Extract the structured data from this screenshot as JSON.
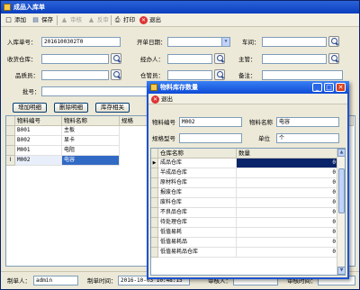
{
  "window": {
    "title": "成品入库单"
  },
  "toolbar": {
    "add": "添加",
    "save": "保存",
    "review": "审核",
    "unreview": "反审",
    "print": "打印",
    "exit": "退出"
  },
  "form": {
    "doc_no_label": "入库单号：",
    "doc_no_value": "2016100302T0",
    "dev_date_label": "开单日期：",
    "workshop_label": "车间：",
    "warehouse_label": "收货仓库：",
    "handler_label": "经办人：",
    "supervisor_label": "主管：",
    "inspector_label": "品质员：",
    "keeper_label": "仓管员：",
    "remark_label": "备注：",
    "batch_label": "批号："
  },
  "buttons": {
    "add_detail": "增加明细",
    "del_detail": "删除明细",
    "stock_related": "库存相关"
  },
  "grid": {
    "headers": [
      "物料编号",
      "物料名称",
      "规格"
    ],
    "rows": [
      [
        "B001",
        "主板"
      ],
      [
        "B002",
        "显卡"
      ],
      [
        "M001",
        "电阻"
      ],
      [
        "M002",
        "电容"
      ]
    ]
  },
  "status": {
    "maker_label": "制单人：",
    "maker_value": "admin",
    "make_time_label": "制单时间：",
    "make_time_value": "2016-10-03 10:48:15",
    "reviewer_label": "审核人：",
    "review_time_label": "审核时间："
  },
  "popup": {
    "title": "物料库存数量",
    "exit": "退出",
    "item_no_label": "物料编号",
    "item_no_value": "M002",
    "item_name_label": "物料名称",
    "item_name_value": "电容",
    "spec_label": "规格型号",
    "unit_label": "单位",
    "unit_value": "个",
    "headers": [
      "仓库名称",
      "数量"
    ],
    "rows": [
      [
        "成品仓库",
        "0"
      ],
      [
        "半成品仓库",
        "0"
      ],
      [
        "原材料仓库",
        "0"
      ],
      [
        "报废仓库",
        "0"
      ],
      [
        "废料仓库",
        "0"
      ],
      [
        "不良品仓库",
        "0"
      ],
      [
        "待处理仓库",
        "0"
      ],
      [
        "低值易耗",
        "0"
      ],
      [
        "低值易耗品",
        "0"
      ],
      [
        "低值易耗品仓库",
        "0"
      ]
    ]
  }
}
